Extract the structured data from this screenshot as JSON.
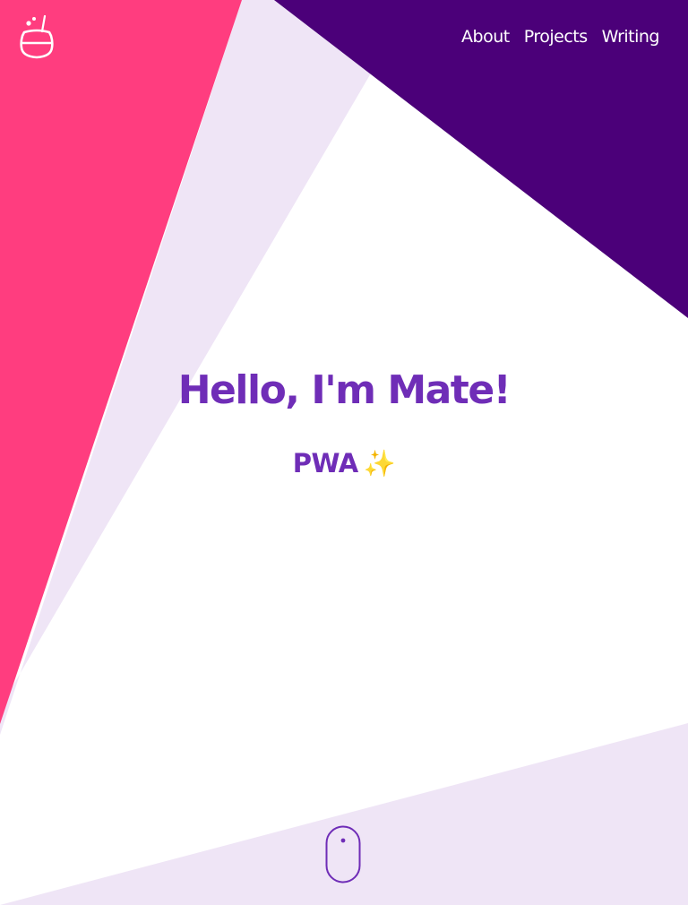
{
  "header": {
    "logo_icon": "cauldron-icon",
    "nav": {
      "about": "About",
      "projects": "Projects",
      "writing": "Writing"
    }
  },
  "hero": {
    "title": "Hello, I'm Mate!",
    "subtitle": "PWA",
    "subtitle_emoji": "✨"
  },
  "scroll_indicator_icon": "mouse-icon",
  "colors": {
    "pink": "#ff3d7f",
    "lavender": "#efe5f6",
    "purple_dark": "#4b0079",
    "heading": "#6f2db7",
    "nav_text": "#ffffff"
  }
}
